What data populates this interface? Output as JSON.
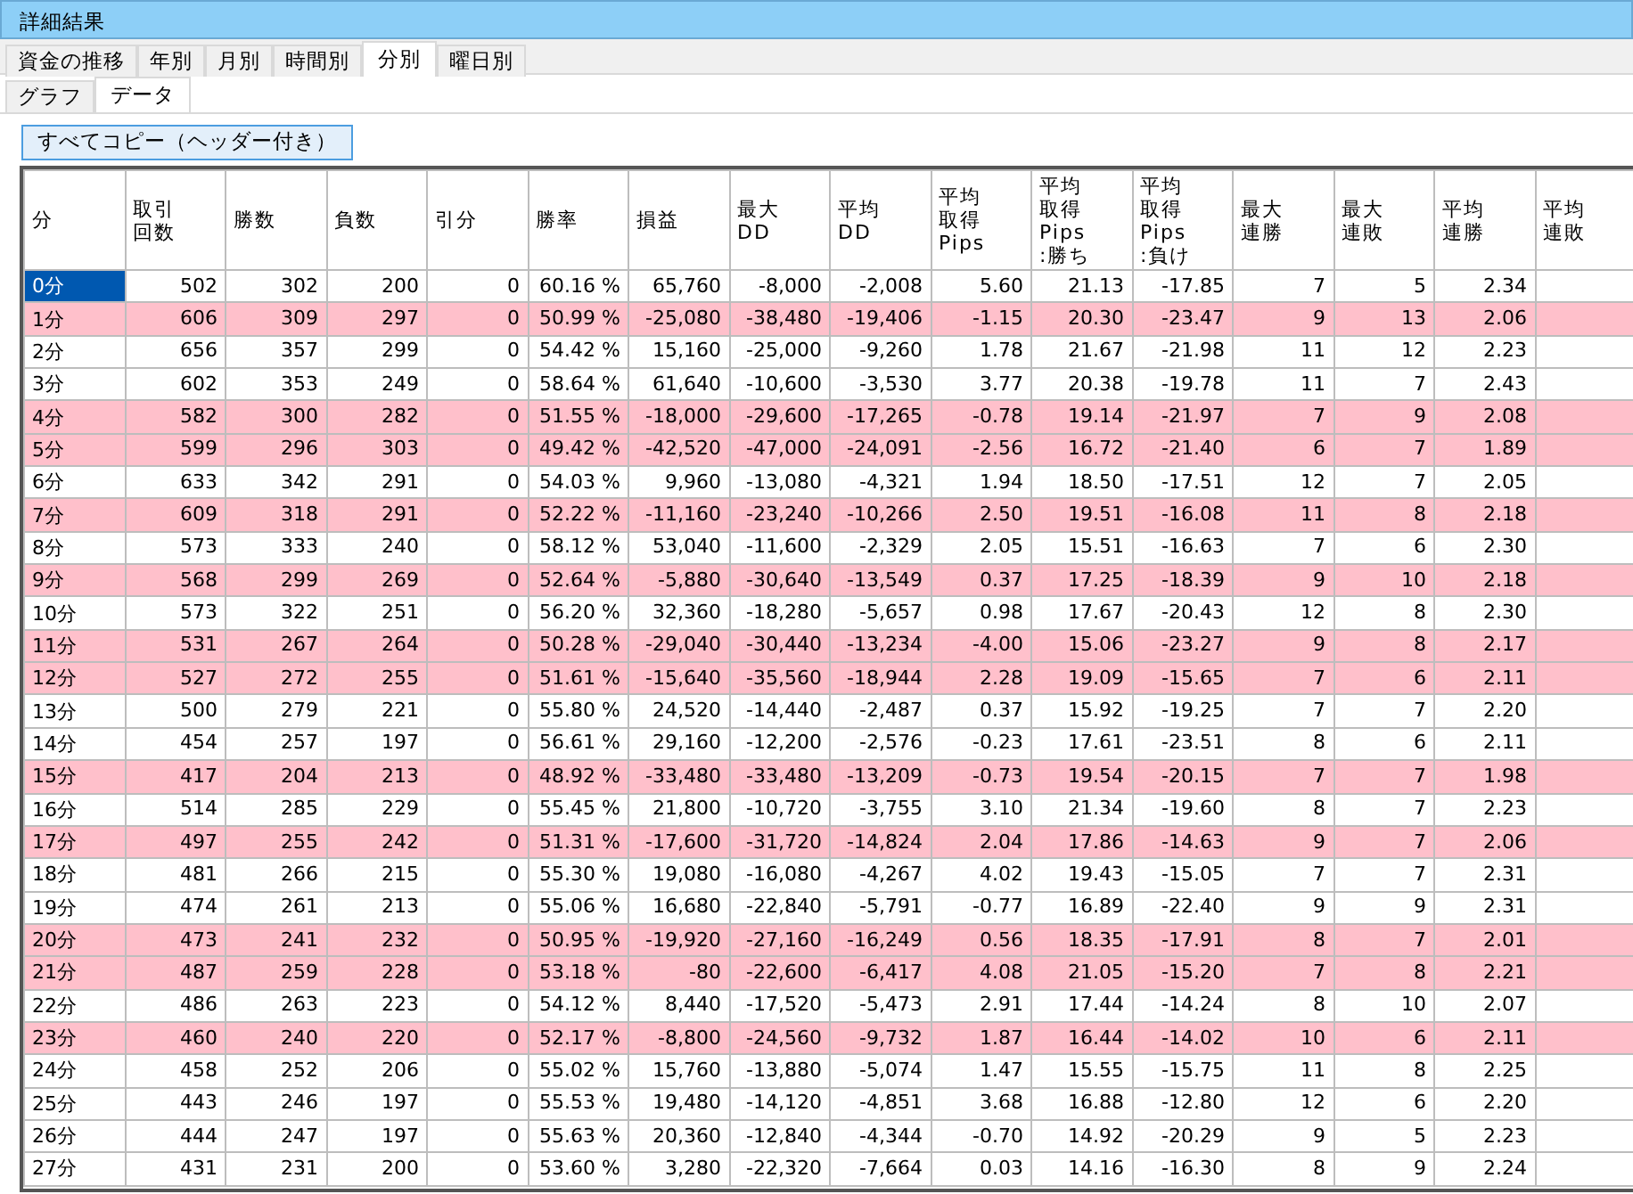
{
  "window": {
    "title": "詳細結果"
  },
  "tabs": [
    {
      "label": "資金の推移",
      "selected": false
    },
    {
      "label": "年別",
      "selected": false
    },
    {
      "label": "月別",
      "selected": false
    },
    {
      "label": "時間別",
      "selected": false
    },
    {
      "label": "分別",
      "selected": true
    },
    {
      "label": "曜日別",
      "selected": false
    }
  ],
  "subtabs": [
    {
      "label": "グラフ",
      "selected": false
    },
    {
      "label": "データ",
      "selected": true
    }
  ],
  "copy_button": "すべてコピー（ヘッダー付き）",
  "table": {
    "columns": [
      "分",
      "取引回数",
      "勝数",
      "負数",
      "引分",
      "勝率",
      "損益",
      "最大DD",
      "平均DD",
      "平均取得Pips",
      "平均取得Pips:勝ち",
      "平均取得Pips:負け",
      "最大連勝",
      "最大連敗",
      "平均連勝",
      "平均連敗"
    ],
    "rows": [
      {
        "loss": false,
        "selected": true,
        "cells": [
          "0分",
          "502",
          "302",
          "200",
          "0",
          "60.16 %",
          "65,760",
          "-8,000",
          "-2,008",
          "5.60",
          "21.13",
          "-17.85",
          "7",
          "5",
          "2.34"
        ]
      },
      {
        "loss": true,
        "selected": false,
        "cells": [
          "1分",
          "606",
          "309",
          "297",
          "0",
          "50.99 %",
          "-25,080",
          "-38,480",
          "-19,406",
          "-1.15",
          "20.30",
          "-23.47",
          "9",
          "13",
          "2.06"
        ]
      },
      {
        "loss": false,
        "selected": false,
        "cells": [
          "2分",
          "656",
          "357",
          "299",
          "0",
          "54.42 %",
          "15,160",
          "-25,000",
          "-9,260",
          "1.78",
          "21.67",
          "-21.98",
          "11",
          "12",
          "2.23"
        ]
      },
      {
        "loss": false,
        "selected": false,
        "cells": [
          "3分",
          "602",
          "353",
          "249",
          "0",
          "58.64 %",
          "61,640",
          "-10,600",
          "-3,530",
          "3.77",
          "20.38",
          "-19.78",
          "11",
          "7",
          "2.43"
        ]
      },
      {
        "loss": true,
        "selected": false,
        "cells": [
          "4分",
          "582",
          "300",
          "282",
          "0",
          "51.55 %",
          "-18,000",
          "-29,600",
          "-17,265",
          "-0.78",
          "19.14",
          "-21.97",
          "7",
          "9",
          "2.08"
        ]
      },
      {
        "loss": true,
        "selected": false,
        "cells": [
          "5分",
          "599",
          "296",
          "303",
          "0",
          "49.42 %",
          "-42,520",
          "-47,000",
          "-24,091",
          "-2.56",
          "16.72",
          "-21.40",
          "6",
          "7",
          "1.89"
        ]
      },
      {
        "loss": false,
        "selected": false,
        "cells": [
          "6分",
          "633",
          "342",
          "291",
          "0",
          "54.03 %",
          "9,960",
          "-13,080",
          "-4,321",
          "1.94",
          "18.50",
          "-17.51",
          "12",
          "7",
          "2.05"
        ]
      },
      {
        "loss": true,
        "selected": false,
        "cells": [
          "7分",
          "609",
          "318",
          "291",
          "0",
          "52.22 %",
          "-11,160",
          "-23,240",
          "-10,266",
          "2.50",
          "19.51",
          "-16.08",
          "11",
          "8",
          "2.18"
        ]
      },
      {
        "loss": false,
        "selected": false,
        "cells": [
          "8分",
          "573",
          "333",
          "240",
          "0",
          "58.12 %",
          "53,040",
          "-11,600",
          "-2,329",
          "2.05",
          "15.51",
          "-16.63",
          "7",
          "6",
          "2.30"
        ]
      },
      {
        "loss": true,
        "selected": false,
        "cells": [
          "9分",
          "568",
          "299",
          "269",
          "0",
          "52.64 %",
          "-5,880",
          "-30,640",
          "-13,549",
          "0.37",
          "17.25",
          "-18.39",
          "9",
          "10",
          "2.18"
        ]
      },
      {
        "loss": false,
        "selected": false,
        "cells": [
          "10分",
          "573",
          "322",
          "251",
          "0",
          "56.20 %",
          "32,360",
          "-18,280",
          "-5,657",
          "0.98",
          "17.67",
          "-20.43",
          "12",
          "8",
          "2.30"
        ]
      },
      {
        "loss": true,
        "selected": false,
        "cells": [
          "11分",
          "531",
          "267",
          "264",
          "0",
          "50.28 %",
          "-29,040",
          "-30,440",
          "-13,234",
          "-4.00",
          "15.06",
          "-23.27",
          "9",
          "8",
          "2.17"
        ]
      },
      {
        "loss": true,
        "selected": false,
        "cells": [
          "12分",
          "527",
          "272",
          "255",
          "0",
          "51.61 %",
          "-15,640",
          "-35,560",
          "-18,944",
          "2.28",
          "19.09",
          "-15.65",
          "7",
          "6",
          "2.11"
        ]
      },
      {
        "loss": false,
        "selected": false,
        "cells": [
          "13分",
          "500",
          "279",
          "221",
          "0",
          "55.80 %",
          "24,520",
          "-14,440",
          "-2,487",
          "0.37",
          "15.92",
          "-19.25",
          "7",
          "7",
          "2.20"
        ]
      },
      {
        "loss": false,
        "selected": false,
        "cells": [
          "14分",
          "454",
          "257",
          "197",
          "0",
          "56.61 %",
          "29,160",
          "-12,200",
          "-2,576",
          "-0.23",
          "17.61",
          "-23.51",
          "8",
          "6",
          "2.11"
        ]
      },
      {
        "loss": true,
        "selected": false,
        "cells": [
          "15分",
          "417",
          "204",
          "213",
          "0",
          "48.92 %",
          "-33,480",
          "-33,480",
          "-13,209",
          "-0.73",
          "19.54",
          "-20.15",
          "7",
          "7",
          "1.98"
        ]
      },
      {
        "loss": false,
        "selected": false,
        "cells": [
          "16分",
          "514",
          "285",
          "229",
          "0",
          "55.45 %",
          "21,800",
          "-10,720",
          "-3,755",
          "3.10",
          "21.34",
          "-19.60",
          "8",
          "7",
          "2.23"
        ]
      },
      {
        "loss": true,
        "selected": false,
        "cells": [
          "17分",
          "497",
          "255",
          "242",
          "0",
          "51.31 %",
          "-17,600",
          "-31,720",
          "-14,824",
          "2.04",
          "17.86",
          "-14.63",
          "9",
          "7",
          "2.06"
        ]
      },
      {
        "loss": false,
        "selected": false,
        "cells": [
          "18分",
          "481",
          "266",
          "215",
          "0",
          "55.30 %",
          "19,080",
          "-16,080",
          "-4,267",
          "4.02",
          "19.43",
          "-15.05",
          "7",
          "7",
          "2.31"
        ]
      },
      {
        "loss": false,
        "selected": false,
        "cells": [
          "19分",
          "474",
          "261",
          "213",
          "0",
          "55.06 %",
          "16,680",
          "-22,840",
          "-5,791",
          "-0.77",
          "16.89",
          "-22.40",
          "9",
          "9",
          "2.31"
        ]
      },
      {
        "loss": true,
        "selected": false,
        "cells": [
          "20分",
          "473",
          "241",
          "232",
          "0",
          "50.95 %",
          "-19,920",
          "-27,160",
          "-16,249",
          "0.56",
          "18.35",
          "-17.91",
          "8",
          "7",
          "2.01"
        ]
      },
      {
        "loss": true,
        "selected": false,
        "cells": [
          "21分",
          "487",
          "259",
          "228",
          "0",
          "53.18 %",
          "-80",
          "-22,600",
          "-6,417",
          "4.08",
          "21.05",
          "-15.20",
          "7",
          "8",
          "2.21"
        ]
      },
      {
        "loss": false,
        "selected": false,
        "cells": [
          "22分",
          "486",
          "263",
          "223",
          "0",
          "54.12 %",
          "8,440",
          "-17,520",
          "-5,473",
          "2.91",
          "17.44",
          "-14.24",
          "8",
          "10",
          "2.07"
        ]
      },
      {
        "loss": true,
        "selected": false,
        "cells": [
          "23分",
          "460",
          "240",
          "220",
          "0",
          "52.17 %",
          "-8,800",
          "-24,560",
          "-9,732",
          "1.87",
          "16.44",
          "-14.02",
          "10",
          "6",
          "2.11"
        ]
      },
      {
        "loss": false,
        "selected": false,
        "cells": [
          "24分",
          "458",
          "252",
          "206",
          "0",
          "55.02 %",
          "15,760",
          "-13,880",
          "-5,074",
          "1.47",
          "15.55",
          "-15.75",
          "11",
          "8",
          "2.25"
        ]
      },
      {
        "loss": false,
        "selected": false,
        "cells": [
          "25分",
          "443",
          "246",
          "197",
          "0",
          "55.53 %",
          "19,480",
          "-14,120",
          "-4,851",
          "3.68",
          "16.88",
          "-12.80",
          "12",
          "6",
          "2.20"
        ]
      },
      {
        "loss": false,
        "selected": false,
        "cells": [
          "26分",
          "444",
          "247",
          "197",
          "0",
          "55.63 %",
          "20,360",
          "-12,840",
          "-4,344",
          "-0.70",
          "14.92",
          "-20.29",
          "9",
          "5",
          "2.23"
        ]
      },
      {
        "loss": false,
        "selected": false,
        "cells": [
          "27分",
          "431",
          "231",
          "200",
          "0",
          "53.60 %",
          "3,280",
          "-22,320",
          "-7,664",
          "0.03",
          "14.16",
          "-16.30",
          "8",
          "9",
          "2.24"
        ]
      }
    ]
  }
}
